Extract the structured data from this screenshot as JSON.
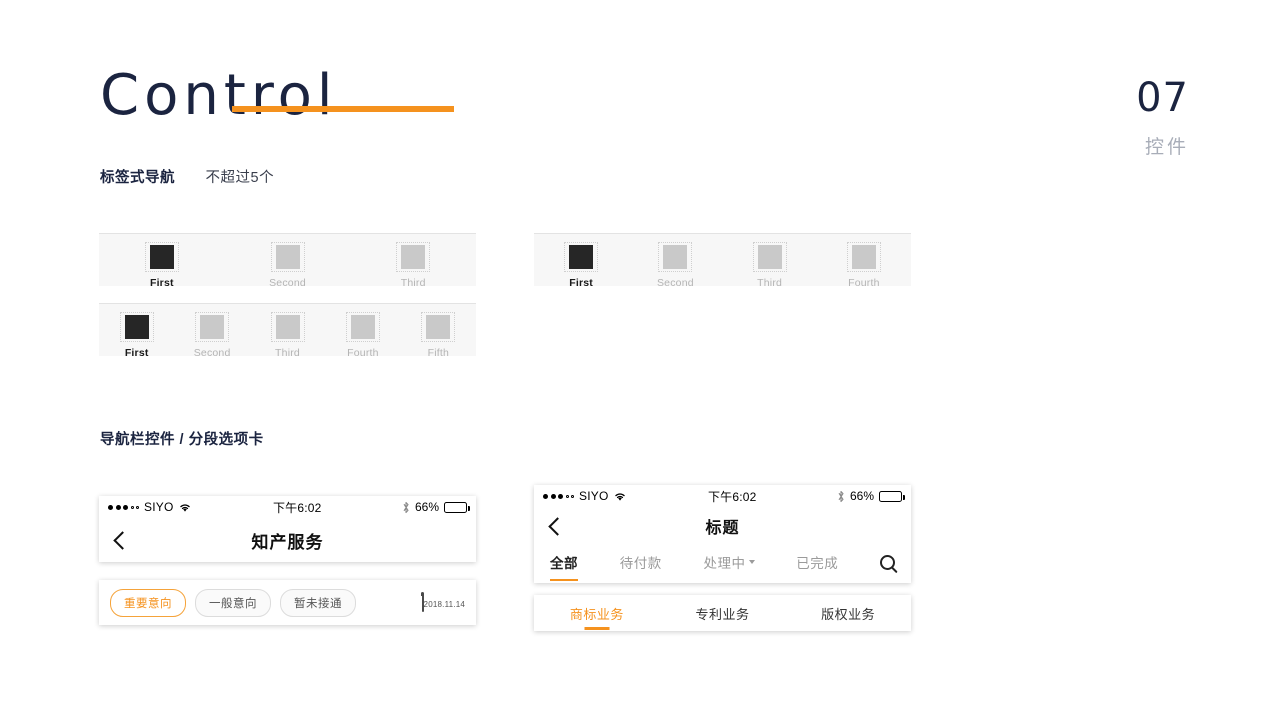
{
  "header": {
    "title": "Control",
    "number": "07",
    "number_sub": "控件",
    "accent_color": "#f5921e",
    "title_color": "#1b2440"
  },
  "sections": [
    {
      "label": "标签式导航",
      "note": "不超过5个"
    },
    {
      "label": "导航栏控件  /  分段选项卡",
      "note": ""
    }
  ],
  "tabbars": [
    {
      "name": "three-tab-bar",
      "tabs": [
        {
          "label": "First",
          "active": true
        },
        {
          "label": "Second",
          "active": false
        },
        {
          "label": "Third",
          "active": false
        }
      ]
    },
    {
      "name": "five-tab-bar",
      "tabs": [
        {
          "label": "First",
          "active": true
        },
        {
          "label": "Second",
          "active": false
        },
        {
          "label": "Third",
          "active": false
        },
        {
          "label": "Fourth",
          "active": false
        },
        {
          "label": "Fifth",
          "active": false
        }
      ]
    },
    {
      "name": "four-tab-bar",
      "tabs": [
        {
          "label": "First",
          "active": true
        },
        {
          "label": "Second",
          "active": false
        },
        {
          "label": "Third",
          "active": false
        },
        {
          "label": "Fourth",
          "active": false
        }
      ]
    }
  ],
  "status_bar": {
    "carrier": "SIYO",
    "time": "下午6:02",
    "battery_percent": "66%",
    "signal_dots_filled": 3,
    "signal_dots_empty": 2,
    "wifi_icon": "wifi-icon",
    "bluetooth_icon": "bluetooth-icon",
    "battery_icon": "battery-icon"
  },
  "phone_left": {
    "back_icon": "back-chevron-icon",
    "nav_title": "知产服务",
    "chips": [
      {
        "label": "重要意向",
        "active": true
      },
      {
        "label": "一般意向",
        "active": false
      },
      {
        "label": "暂未接通",
        "active": false
      }
    ],
    "calendar": {
      "icon": "calendar-icon",
      "date": "2018.11.14"
    }
  },
  "phone_right": {
    "back_icon": "back-chevron-icon",
    "nav_title": "标题",
    "segments": [
      {
        "label": "全部",
        "active": true,
        "caret": false
      },
      {
        "label": "待付款",
        "active": false,
        "caret": false
      },
      {
        "label": "处理中",
        "active": false,
        "caret": true
      },
      {
        "label": "已完成",
        "active": false,
        "caret": false
      }
    ],
    "search_icon": "search-icon",
    "sub_segments": [
      {
        "label": "商标业务",
        "active": true
      },
      {
        "label": "专利业务",
        "active": false
      },
      {
        "label": "版权业务",
        "active": false
      }
    ]
  }
}
